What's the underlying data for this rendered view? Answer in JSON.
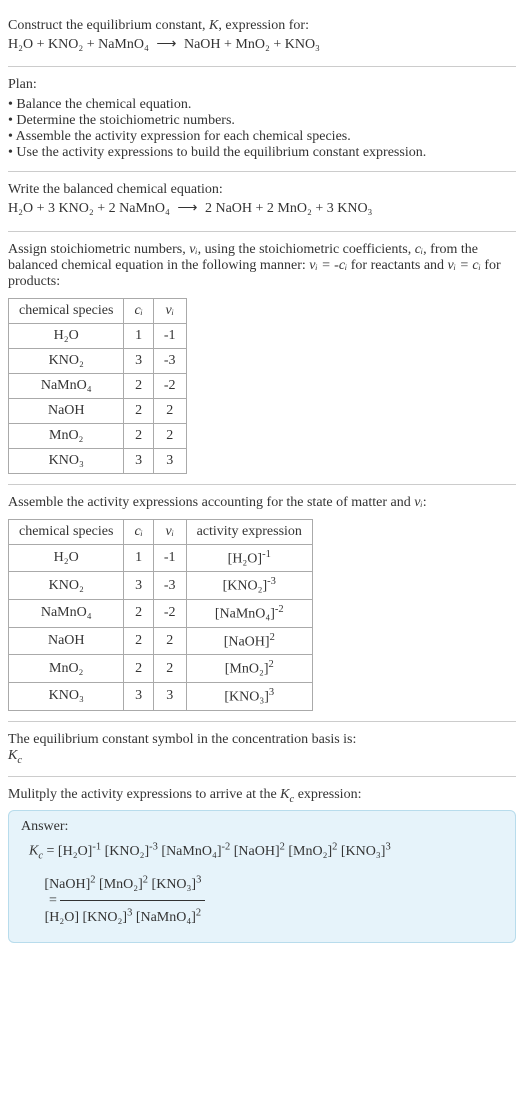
{
  "s1": {
    "line1": "Construct the equilibrium constant, ",
    "K": "K",
    "line1b": ", expression for:",
    "eq_lhs": "H₂O + KNO₂ + NaMnO₄",
    "arrow": "⟶",
    "eq_rhs": "NaOH + MnO₂ + KNO₃"
  },
  "s2": {
    "title": "Plan:",
    "items": [
      "Balance the chemical equation.",
      "Determine the stoichiometric numbers.",
      "Assemble the activity expression for each chemical species.",
      "Use the activity expressions to build the equilibrium constant expression."
    ]
  },
  "s3": {
    "title": "Write the balanced chemical equation:",
    "eq_lhs": "H₂O + 3 KNO₂ + 2 NaMnO₄",
    "arrow": "⟶",
    "eq_rhs": "2 NaOH + 2 MnO₂ + 3 KNO₃"
  },
  "s4": {
    "intro1": "Assign stoichiometric numbers, ",
    "nu": "νᵢ",
    "intro2": ", using the stoichiometric coefficients, ",
    "ci": "cᵢ",
    "intro3": ", from the balanced chemical equation in the following manner: ",
    "rel1": "νᵢ = -cᵢ",
    "intro4": " for reactants and ",
    "rel2": "νᵢ = cᵢ",
    "intro5": " for products:",
    "headers": [
      "chemical species",
      "cᵢ",
      "νᵢ"
    ],
    "rows": [
      [
        "H₂O",
        "1",
        "-1"
      ],
      [
        "KNO₂",
        "3",
        "-3"
      ],
      [
        "NaMnO₄",
        "2",
        "-2"
      ],
      [
        "NaOH",
        "2",
        "2"
      ],
      [
        "MnO₂",
        "2",
        "2"
      ],
      [
        "KNO₃",
        "3",
        "3"
      ]
    ]
  },
  "s5": {
    "title1": "Assemble the activity expressions accounting for the state of matter and ",
    "nu": "νᵢ",
    "title2": ":",
    "headers": [
      "chemical species",
      "cᵢ",
      "νᵢ",
      "activity expression"
    ],
    "rows": [
      {
        "sp": "H₂O",
        "c": "1",
        "v": "-1",
        "base": "[H₂O]",
        "exp": "-1"
      },
      {
        "sp": "KNO₂",
        "c": "3",
        "v": "-3",
        "base": "[KNO₂]",
        "exp": "-3"
      },
      {
        "sp": "NaMnO₄",
        "c": "2",
        "v": "-2",
        "base": "[NaMnO₄]",
        "exp": "-2"
      },
      {
        "sp": "NaOH",
        "c": "2",
        "v": "2",
        "base": "[NaOH]",
        "exp": "2"
      },
      {
        "sp": "MnO₂",
        "c": "2",
        "v": "2",
        "base": "[MnO₂]",
        "exp": "2"
      },
      {
        "sp": "KNO₃",
        "c": "3",
        "v": "3",
        "base": "[KNO₃]",
        "exp": "3"
      }
    ]
  },
  "s6": {
    "line1": "The equilibrium constant symbol in the concentration basis is:",
    "kc": "K",
    "kcsub": "c"
  },
  "s7": {
    "title1": "Mulitply the activity expressions to arrive at the ",
    "kc": "K",
    "kcsub": "c",
    "title2": " expression:"
  },
  "answer": {
    "label": "Answer:",
    "lhs": "K",
    "lhssub": "c",
    "eq": " = ",
    "terms": [
      {
        "b": "[H₂O]",
        "e": "-1"
      },
      {
        "b": "[KNO₂]",
        "e": "-3"
      },
      {
        "b": "[NaMnO₄]",
        "e": "-2"
      },
      {
        "b": "[NaOH]",
        "e": "2"
      },
      {
        "b": "[MnO₂]",
        "e": "2"
      },
      {
        "b": "[KNO₃]",
        "e": "3"
      }
    ],
    "eq2": " = ",
    "num": [
      {
        "b": "[NaOH]",
        "e": "2"
      },
      {
        "b": "[MnO₂]",
        "e": "2"
      },
      {
        "b": "[KNO₃]",
        "e": "3"
      }
    ],
    "den": [
      {
        "b": "[H₂O]",
        "e": ""
      },
      {
        "b": "[KNO₂]",
        "e": "3"
      },
      {
        "b": "[NaMnO₄]",
        "e": "2"
      }
    ]
  },
  "chart_data": {
    "type": "table",
    "stoichiometry": {
      "columns": [
        "chemical species",
        "c_i",
        "nu_i"
      ],
      "rows": [
        [
          "H2O",
          1,
          -1
        ],
        [
          "KNO2",
          3,
          -3
        ],
        [
          "NaMnO4",
          2,
          -2
        ],
        [
          "NaOH",
          2,
          2
        ],
        [
          "MnO2",
          2,
          2
        ],
        [
          "KNO3",
          3,
          3
        ]
      ]
    },
    "activity": {
      "columns": [
        "chemical species",
        "c_i",
        "nu_i",
        "activity expression"
      ],
      "rows": [
        [
          "H2O",
          1,
          -1,
          "[H2O]^-1"
        ],
        [
          "KNO2",
          3,
          -3,
          "[KNO2]^-3"
        ],
        [
          "NaMnO4",
          2,
          -2,
          "[NaMnO4]^-2"
        ],
        [
          "NaOH",
          2,
          2,
          "[NaOH]^2"
        ],
        [
          "MnO2",
          2,
          2,
          "[MnO2]^2"
        ],
        [
          "KNO3",
          3,
          3,
          "[KNO3]^3"
        ]
      ]
    }
  }
}
